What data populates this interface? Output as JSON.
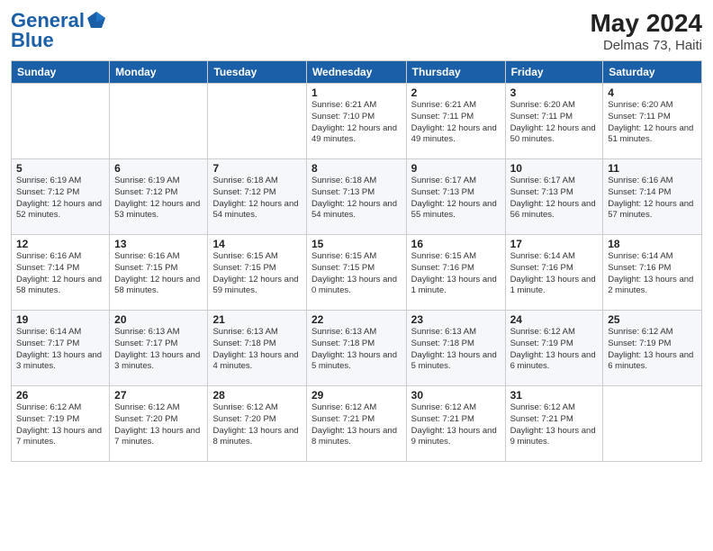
{
  "header": {
    "logo_line1": "General",
    "logo_line2": "Blue",
    "month_year": "May 2024",
    "location": "Delmas 73, Haiti"
  },
  "days_of_week": [
    "Sunday",
    "Monday",
    "Tuesday",
    "Wednesday",
    "Thursday",
    "Friday",
    "Saturday"
  ],
  "weeks": [
    [
      {
        "day": "",
        "info": ""
      },
      {
        "day": "",
        "info": ""
      },
      {
        "day": "",
        "info": ""
      },
      {
        "day": "1",
        "info": "Sunrise: 6:21 AM\nSunset: 7:10 PM\nDaylight: 12 hours\nand 49 minutes."
      },
      {
        "day": "2",
        "info": "Sunrise: 6:21 AM\nSunset: 7:11 PM\nDaylight: 12 hours\nand 49 minutes."
      },
      {
        "day": "3",
        "info": "Sunrise: 6:20 AM\nSunset: 7:11 PM\nDaylight: 12 hours\nand 50 minutes."
      },
      {
        "day": "4",
        "info": "Sunrise: 6:20 AM\nSunset: 7:11 PM\nDaylight: 12 hours\nand 51 minutes."
      }
    ],
    [
      {
        "day": "5",
        "info": "Sunrise: 6:19 AM\nSunset: 7:12 PM\nDaylight: 12 hours\nand 52 minutes."
      },
      {
        "day": "6",
        "info": "Sunrise: 6:19 AM\nSunset: 7:12 PM\nDaylight: 12 hours\nand 53 minutes."
      },
      {
        "day": "7",
        "info": "Sunrise: 6:18 AM\nSunset: 7:12 PM\nDaylight: 12 hours\nand 54 minutes."
      },
      {
        "day": "8",
        "info": "Sunrise: 6:18 AM\nSunset: 7:13 PM\nDaylight: 12 hours\nand 54 minutes."
      },
      {
        "day": "9",
        "info": "Sunrise: 6:17 AM\nSunset: 7:13 PM\nDaylight: 12 hours\nand 55 minutes."
      },
      {
        "day": "10",
        "info": "Sunrise: 6:17 AM\nSunset: 7:13 PM\nDaylight: 12 hours\nand 56 minutes."
      },
      {
        "day": "11",
        "info": "Sunrise: 6:16 AM\nSunset: 7:14 PM\nDaylight: 12 hours\nand 57 minutes."
      }
    ],
    [
      {
        "day": "12",
        "info": "Sunrise: 6:16 AM\nSunset: 7:14 PM\nDaylight: 12 hours\nand 58 minutes."
      },
      {
        "day": "13",
        "info": "Sunrise: 6:16 AM\nSunset: 7:15 PM\nDaylight: 12 hours\nand 58 minutes."
      },
      {
        "day": "14",
        "info": "Sunrise: 6:15 AM\nSunset: 7:15 PM\nDaylight: 12 hours\nand 59 minutes."
      },
      {
        "day": "15",
        "info": "Sunrise: 6:15 AM\nSunset: 7:15 PM\nDaylight: 13 hours\nand 0 minutes."
      },
      {
        "day": "16",
        "info": "Sunrise: 6:15 AM\nSunset: 7:16 PM\nDaylight: 13 hours\nand 1 minute."
      },
      {
        "day": "17",
        "info": "Sunrise: 6:14 AM\nSunset: 7:16 PM\nDaylight: 13 hours\nand 1 minute."
      },
      {
        "day": "18",
        "info": "Sunrise: 6:14 AM\nSunset: 7:16 PM\nDaylight: 13 hours\nand 2 minutes."
      }
    ],
    [
      {
        "day": "19",
        "info": "Sunrise: 6:14 AM\nSunset: 7:17 PM\nDaylight: 13 hours\nand 3 minutes."
      },
      {
        "day": "20",
        "info": "Sunrise: 6:13 AM\nSunset: 7:17 PM\nDaylight: 13 hours\nand 3 minutes."
      },
      {
        "day": "21",
        "info": "Sunrise: 6:13 AM\nSunset: 7:18 PM\nDaylight: 13 hours\nand 4 minutes."
      },
      {
        "day": "22",
        "info": "Sunrise: 6:13 AM\nSunset: 7:18 PM\nDaylight: 13 hours\nand 5 minutes."
      },
      {
        "day": "23",
        "info": "Sunrise: 6:13 AM\nSunset: 7:18 PM\nDaylight: 13 hours\nand 5 minutes."
      },
      {
        "day": "24",
        "info": "Sunrise: 6:12 AM\nSunset: 7:19 PM\nDaylight: 13 hours\nand 6 minutes."
      },
      {
        "day": "25",
        "info": "Sunrise: 6:12 AM\nSunset: 7:19 PM\nDaylight: 13 hours\nand 6 minutes."
      }
    ],
    [
      {
        "day": "26",
        "info": "Sunrise: 6:12 AM\nSunset: 7:19 PM\nDaylight: 13 hours\nand 7 minutes."
      },
      {
        "day": "27",
        "info": "Sunrise: 6:12 AM\nSunset: 7:20 PM\nDaylight: 13 hours\nand 7 minutes."
      },
      {
        "day": "28",
        "info": "Sunrise: 6:12 AM\nSunset: 7:20 PM\nDaylight: 13 hours\nand 8 minutes."
      },
      {
        "day": "29",
        "info": "Sunrise: 6:12 AM\nSunset: 7:21 PM\nDaylight: 13 hours\nand 8 minutes."
      },
      {
        "day": "30",
        "info": "Sunrise: 6:12 AM\nSunset: 7:21 PM\nDaylight: 13 hours\nand 9 minutes."
      },
      {
        "day": "31",
        "info": "Sunrise: 6:12 AM\nSunset: 7:21 PM\nDaylight: 13 hours\nand 9 minutes."
      },
      {
        "day": "",
        "info": ""
      }
    ]
  ]
}
